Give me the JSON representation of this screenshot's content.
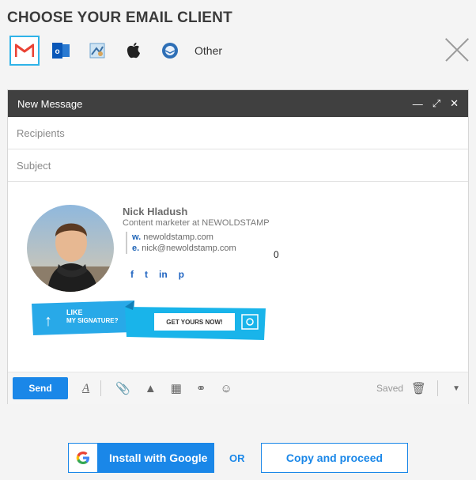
{
  "page": {
    "title": "CHOOSE YOUR EMAIL CLIENT"
  },
  "clients": {
    "items": [
      {
        "name": "Gmail",
        "icon": "gmail-icon",
        "active": true
      },
      {
        "name": "Outlook",
        "icon": "outlook-icon"
      },
      {
        "name": "Apple Mail (photo)",
        "icon": "mail-app-icon"
      },
      {
        "name": "Apple",
        "icon": "apple-icon"
      },
      {
        "name": "Thunderbird",
        "icon": "thunderbird-icon"
      }
    ],
    "other_label": "Other"
  },
  "compose": {
    "window_title": "New Message",
    "recipients_placeholder": "Recipients",
    "subject_placeholder": "Subject",
    "send_label": "Send",
    "saved_label": "Saved"
  },
  "signature": {
    "name": "Nick Hladush",
    "role": "Content marketer at NEWOLDSTAMP",
    "website_prefix": "w.",
    "website": "newoldstamp.com",
    "email_prefix": "e.",
    "email": "nick@newoldstamp.com",
    "stray_text": "0",
    "social": [
      "f",
      "t",
      "in",
      "p"
    ],
    "banner": {
      "line1": "LIKE",
      "line2": "MY SIGNATURE?",
      "cta": "GET YOURS NOW!"
    }
  },
  "actions": {
    "install_label": "Install with Google",
    "or_label": "OR",
    "copy_label": "Copy and proceed"
  },
  "colors": {
    "accent": "#1a87e8",
    "header": "#404040",
    "gmail_red": "#ea4335"
  }
}
